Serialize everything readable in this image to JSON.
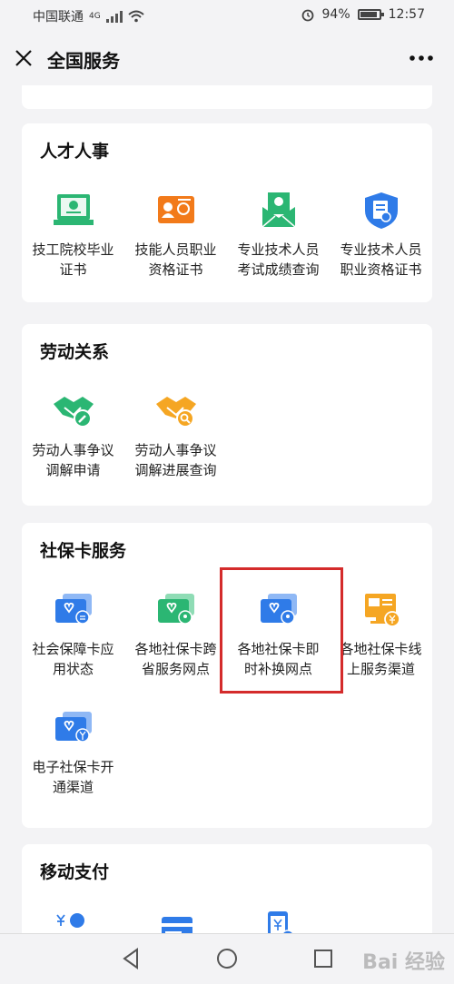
{
  "status": {
    "carrier": "中国联通",
    "network": "4G",
    "battery": "94%",
    "time": "12:57"
  },
  "header": {
    "title": "全国服务"
  },
  "sections": [
    {
      "title": "人才人事",
      "items": [
        {
          "label": "技工院校毕业\n证书",
          "icon": "certificate-icon",
          "color": "#2bb673"
        },
        {
          "label": "技能人员职业\n资格证书",
          "icon": "id-certificate-icon",
          "color": "#f27a1a"
        },
        {
          "label": "专业技术人员\n考试成绩查询",
          "icon": "envelope-certificate-icon",
          "color": "#2bb673"
        },
        {
          "label": "专业技术人员\n职业资格证书",
          "icon": "shield-document-icon",
          "color": "#2f7be8"
        }
      ]
    },
    {
      "title": "劳动关系",
      "items": [
        {
          "label": "劳动人事争议\n调解申请",
          "icon": "handshake-edit-icon",
          "color": "#2bb673"
        },
        {
          "label": "劳动人事争议\n调解进展查询",
          "icon": "handshake-search-icon",
          "color": "#f5a623"
        }
      ]
    },
    {
      "title": "社保卡服务",
      "items": [
        {
          "label": "社会保障卡应\n用状态",
          "icon": "card-heart-icon",
          "color": "#2f7be8"
        },
        {
          "label": "各地社保卡跨\n省服务网点",
          "icon": "card-heart-location-icon",
          "color": "#2bb673"
        },
        {
          "label": "各地社保卡即\n时补换网点",
          "icon": "card-heart-location-icon",
          "color": "#2f7be8"
        },
        {
          "label": "各地社保卡线\n上服务渠道",
          "icon": "monitor-card-icon",
          "color": "#f5a623"
        },
        {
          "label": "电子社保卡开\n通渠道",
          "icon": "card-heart-yuan-icon",
          "color": "#2f7be8"
        }
      ]
    },
    {
      "title": "移动支付",
      "items": [
        {
          "label": "",
          "icon": "person-yuan-icon",
          "color": "#2f7be8"
        },
        {
          "label": "",
          "icon": "card-icon",
          "color": "#2f7be8"
        },
        {
          "label": "",
          "icon": "phone-yuan-icon",
          "color": "#2f7be8"
        }
      ]
    }
  ],
  "watermark": "Bai 经验"
}
